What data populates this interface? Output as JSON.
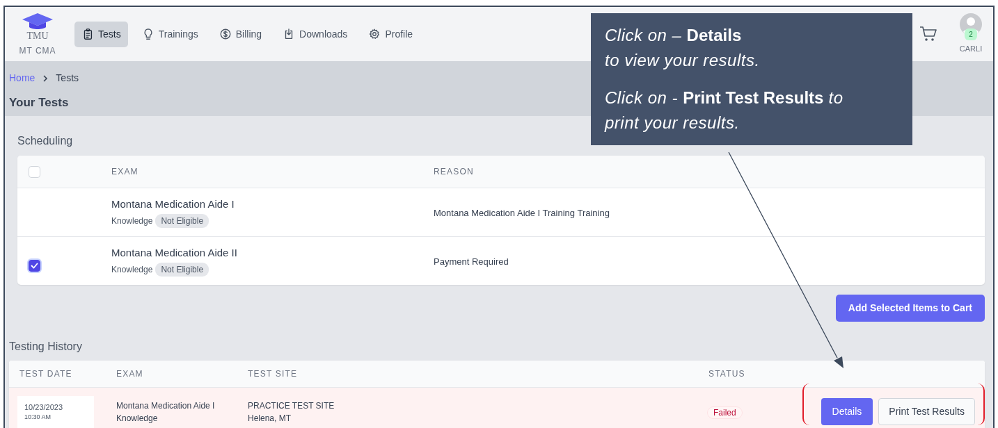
{
  "nav": {
    "logo": {
      "text": "TMU",
      "subtitle": "MT CMA"
    },
    "items": [
      {
        "label": "Tests",
        "selected": true
      },
      {
        "label": "Trainings",
        "selected": false
      },
      {
        "label": "Billing",
        "selected": false
      },
      {
        "label": "Downloads",
        "selected": false
      },
      {
        "label": "Profile",
        "selected": false
      }
    ]
  },
  "user": {
    "name": "CARLI",
    "badge": "2"
  },
  "breadcrumb": [
    "Home",
    "Tests"
  ],
  "page_title": "Your Tests",
  "scheduling": {
    "title": "Scheduling",
    "columns": [
      "EXAM",
      "REASON"
    ],
    "select_all": {
      "checked": false
    },
    "rows": [
      {
        "exam": "Montana Medication Aide I",
        "type": "Knowledge",
        "eligibility": "Not Eligible",
        "reason": "Montana Medication Aide I Training Training"
      },
      {
        "checked": true,
        "exam": "Montana Medication Aide II",
        "type": "Knowledge",
        "eligibility": "Not Eligible",
        "reason": "Payment Required"
      }
    ]
  },
  "add_button": "Add Selected Items to Cart",
  "history": {
    "title": "Testing History",
    "columns": [
      "TEST DATE",
      "EXAM",
      "TEST SITE",
      "STATUS"
    ],
    "rows": [
      {
        "date": "10/23/2023",
        "time": "10:30 AM",
        "exam": "Montana Medication Aide I",
        "exam_type": "Knowledge",
        "site": "PRACTICE TEST SITE",
        "city": "Helena, MT",
        "status": "Failed",
        "actions": [
          "Details",
          "Print Test Results"
        ]
      }
    ]
  },
  "callout": {
    "paragraphs": [
      [
        "Click on – **Details**",
        "to view your results."
      ],
      [
        "Click on - **Print Test Results** to",
        "print your results."
      ]
    ]
  }
}
